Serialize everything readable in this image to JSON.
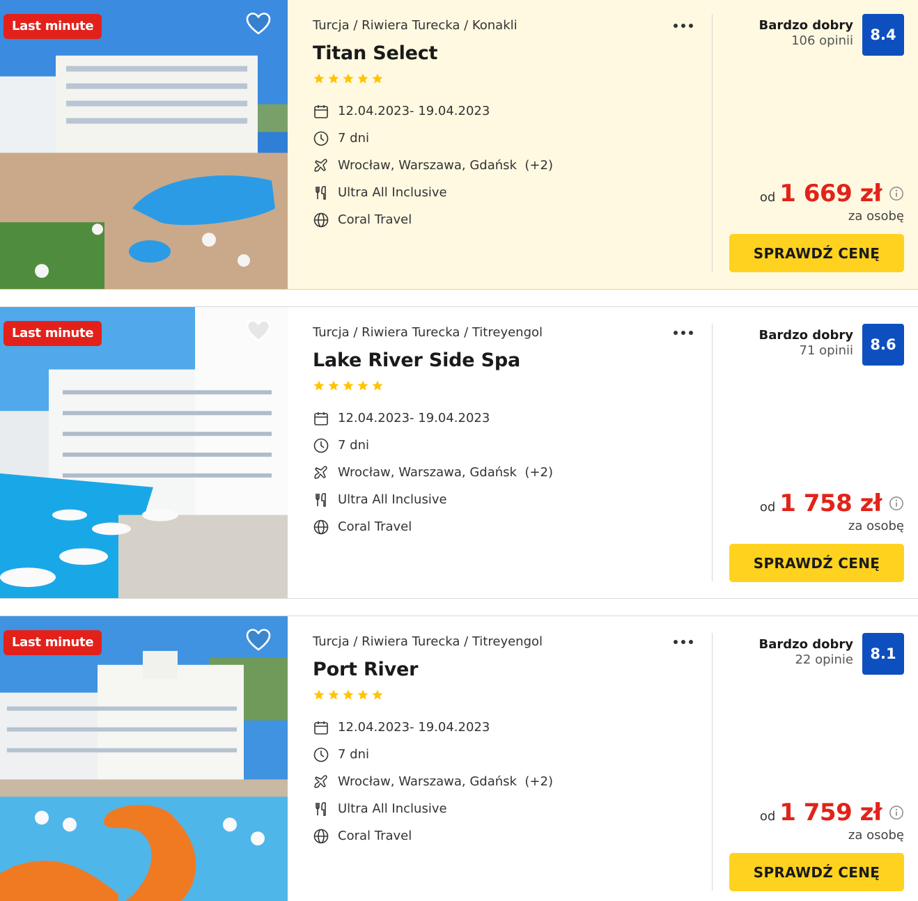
{
  "colors": {
    "badge": "#e3211b",
    "rating_box": "#0e4fbf",
    "price": "#e2231a",
    "cta": "#ffd21f",
    "highlight_bg": "#fff9e1"
  },
  "offers": [
    {
      "badge": "Last minute",
      "breadcrumb": "Turcja / Riwiera Turecka / Konakli",
      "name": "Titan Select",
      "stars": 5,
      "dates": "12.04.2023- 19.04.2023",
      "duration": "7 dni",
      "departure": "Wrocław, Warszawa, Gdańsk  (+2)",
      "board": "Ultra All Inclusive",
      "operator": "Coral Travel",
      "rating_label": "Bardzo dobry",
      "rating_count": "106 opinii",
      "rating_score": "8.4",
      "price_prefix": "od",
      "price": "1 669 zł",
      "price_note": "za osobę",
      "cta": "SPRAWDŹ CENĘ"
    },
    {
      "badge": "Last minute",
      "breadcrumb": "Turcja / Riwiera Turecka / Titreyengol",
      "name": "Lake River Side Spa",
      "stars": 5,
      "dates": "12.04.2023- 19.04.2023",
      "duration": "7 dni",
      "departure": "Wrocław, Warszawa, Gdańsk  (+2)",
      "board": "Ultra All Inclusive",
      "operator": "Coral Travel",
      "rating_label": "Bardzo dobry",
      "rating_count": "71 opinii",
      "rating_score": "8.6",
      "price_prefix": "od",
      "price": "1 758 zł",
      "price_note": "za osobę",
      "cta": "SPRAWDŹ CENĘ"
    },
    {
      "badge": "Last minute",
      "breadcrumb": "Turcja / Riwiera Turecka / Titreyengol",
      "name": "Port River",
      "stars": 5,
      "dates": "12.04.2023- 19.04.2023",
      "duration": "7 dni",
      "departure": "Wrocław, Warszawa, Gdańsk  (+2)",
      "board": "Ultra All Inclusive",
      "operator": "Coral Travel",
      "rating_label": "Bardzo dobry",
      "rating_count": "22 opinie",
      "rating_score": "8.1",
      "price_prefix": "od",
      "price": "1 759 zł",
      "price_note": "za osobę",
      "cta": "SPRAWDŹ CENĘ"
    }
  ]
}
